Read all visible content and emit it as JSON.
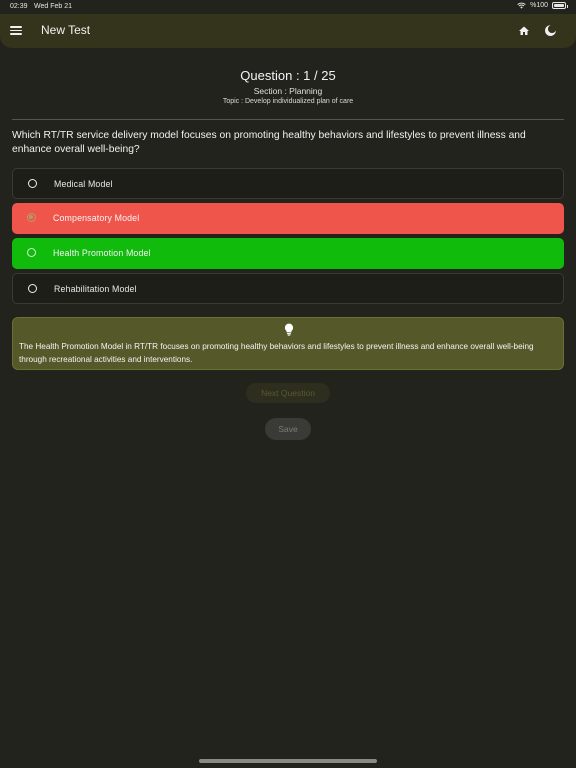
{
  "status_bar": {
    "time": "02:39",
    "date": "Wed Feb 21",
    "battery": "%100"
  },
  "app_bar": {
    "title": "New Test"
  },
  "question": {
    "number": "Question : 1 / 25",
    "section": "Section : Planning",
    "topic": "Topic : Develop individualized plan of care",
    "text": "Which RT/TR service delivery model focuses on promoting healthy behaviors and lifestyles to prevent illness and enhance overall well-being?"
  },
  "options": [
    {
      "label": "Medical Model",
      "state": "default"
    },
    {
      "label": "Compensatory Model",
      "state": "selected-wrong"
    },
    {
      "label": "Health Promotion Model",
      "state": "correct"
    },
    {
      "label": "Rehabilitation Model",
      "state": "default"
    }
  ],
  "explanation": {
    "text": "The Health Promotion Model in RT/TR focuses on promoting healthy behaviors and lifestyles to prevent illness and enhance overall well-being through recreational activities and interventions."
  },
  "actions": {
    "next_label": "Next Question",
    "save_label": "Save"
  },
  "colors": {
    "background": "#23231d",
    "app_bar": "#34341c",
    "wrong": "#f0554c",
    "correct": "#11bb0c",
    "explanation": "#55592a"
  },
  "icons": {
    "menu": "menu-icon",
    "home": "home-icon",
    "theme": "moon-icon",
    "hint": "lightbulb-icon",
    "wifi": "wifi-icon",
    "battery": "battery-icon"
  }
}
